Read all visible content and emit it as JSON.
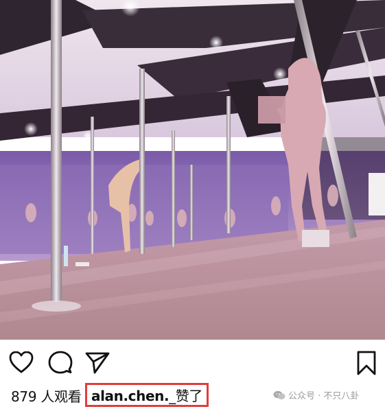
{
  "post": {
    "views_text": "879 人观看",
    "liker_name": "alan.chen.",
    "liker_suffix": "_赞了"
  },
  "actions": {
    "like_icon": "heart-icon",
    "comment_icon": "comment-icon",
    "share_icon": "send-icon",
    "save_icon": "bookmark-icon"
  },
  "watermark": {
    "text": "公众号 · 不只八卦"
  },
  "colors": {
    "highlight_box": "#e23b3b",
    "icon_stroke": "#111111",
    "photo_tint": "#c9a7d8"
  }
}
